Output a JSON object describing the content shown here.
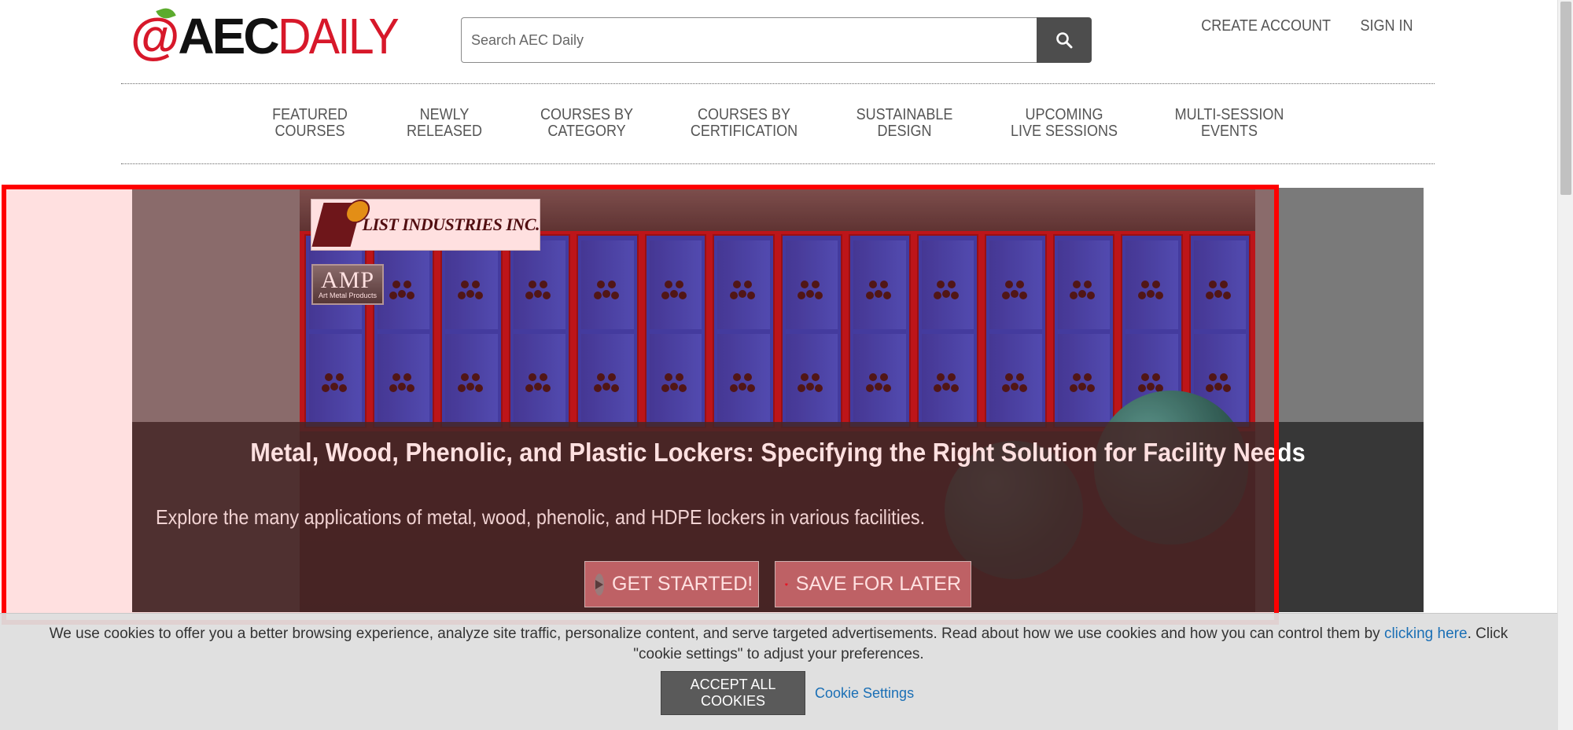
{
  "header": {
    "logo": {
      "at": "@",
      "aec": "AEC",
      "daily": "DAILY"
    },
    "search": {
      "placeholder": "Search AEC Daily",
      "value": "",
      "icon": "search-icon"
    },
    "links": {
      "create_account": "CREATE ACCOUNT",
      "sign_in": "SIGN IN"
    }
  },
  "nav": {
    "items": [
      {
        "label": "FEATURED\nCOURSES"
      },
      {
        "label": "NEWLY\nRELEASED"
      },
      {
        "label": "COURSES BY\nCATEGORY"
      },
      {
        "label": "COURSES BY\nCERTIFICATION"
      },
      {
        "label": "SUSTAINABLE\nDESIGN"
      },
      {
        "label": "UPCOMING\nLIVE SESSIONS"
      },
      {
        "label": "MULTI-SESSION\nEVENTS"
      }
    ]
  },
  "hero": {
    "brand": "LIST INDUSTRIES INC.",
    "amp_logo": {
      "big": "AMP",
      "small": "Art Metal Products"
    },
    "title": "Metal, Wood, Phenolic, and Plastic Lockers: Specifying the Right Solution for Facility Needs",
    "description": "Explore the many applications of metal, wood, phenolic, and HDPE lockers in various facilities.",
    "buttons": {
      "get_started": "GET STARTED!",
      "save_for_later": "SAVE FOR LATER"
    }
  },
  "cookie": {
    "icon_glyph": "",
    "text_before": "We use cookies to offer you a better browsing experience, analyze site traffic, personalize content, and serve targeted advertisements. Read about how we use cookies and how you can control them by ",
    "link": "clicking here",
    "text_after": ". Click \"cookie settings\" to adjust your preferences.",
    "accept": "ACCEPT ALL COOKIES",
    "settings": "Cookie Settings"
  },
  "colors": {
    "brand_red": "#d7182a",
    "highlight": "#ff0000",
    "link_blue": "#1a6fb5",
    "button_dark": "#4d4d4d"
  }
}
